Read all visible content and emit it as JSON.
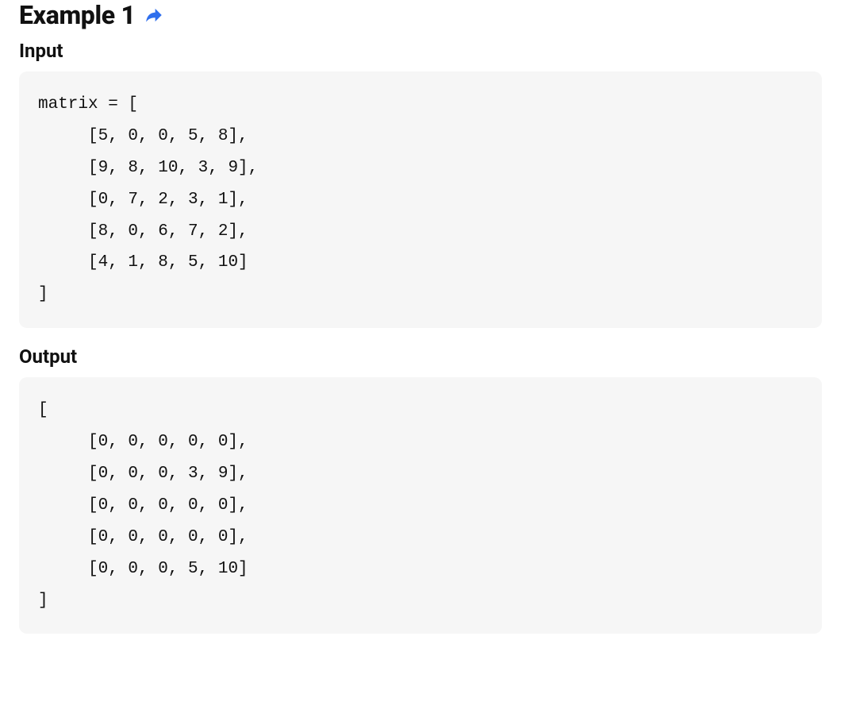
{
  "example": {
    "title": "Example 1",
    "share_icon": "share-icon"
  },
  "sections": {
    "input": {
      "heading": "Input",
      "code": "matrix = [\n     [5, 0, 0, 5, 8],\n     [9, 8, 10, 3, 9],\n     [0, 7, 2, 3, 1],\n     [8, 0, 6, 7, 2],\n     [4, 1, 8, 5, 10]\n]"
    },
    "output": {
      "heading": "Output",
      "code": "[\n     [0, 0, 0, 0, 0],\n     [0, 0, 0, 3, 9],\n     [0, 0, 0, 0, 0],\n     [0, 0, 0, 0, 0],\n     [0, 0, 0, 5, 10]\n]"
    }
  }
}
